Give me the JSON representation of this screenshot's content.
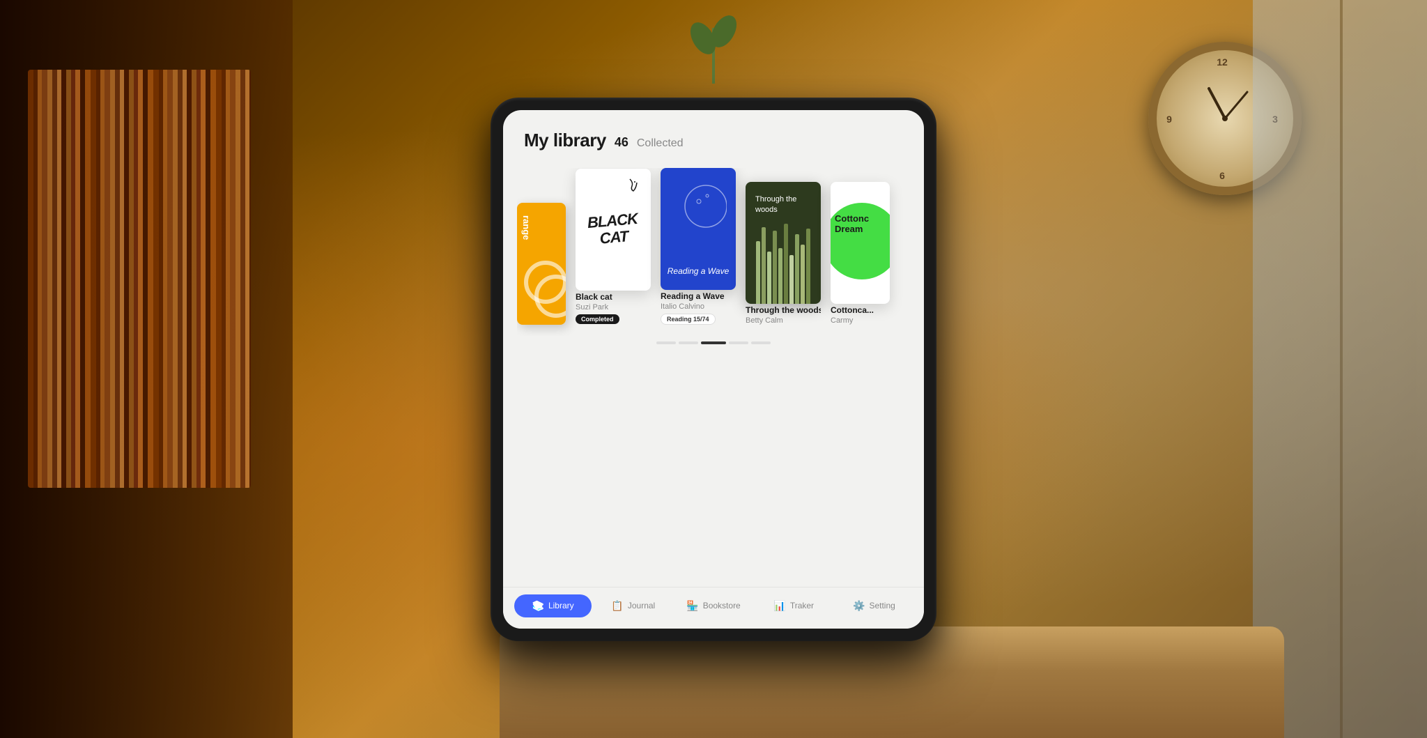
{
  "page": {
    "title": "My library",
    "count": "46",
    "count_label": "Collected"
  },
  "books": [
    {
      "id": "orange",
      "title": "range",
      "author": "",
      "status": null,
      "visible": "partial"
    },
    {
      "id": "black-cat",
      "title": "Black cat",
      "author": "Suzi Park",
      "cover_text": "BLACK CAT",
      "status": "Completed",
      "badge_type": "completed"
    },
    {
      "id": "reading-a-wave",
      "title": "Reading a Wave",
      "author": "Italio Calvino",
      "cover_text": "Reading a Wave",
      "status": "Reading  15/74",
      "badge_type": "reading"
    },
    {
      "id": "through-the-woods",
      "title": "Through the woods",
      "author": "Betty Calm",
      "cover_text": "Through the woods",
      "status": null,
      "badge_type": null
    },
    {
      "id": "cottoncandy",
      "title": "Cottonca...",
      "author": "Carmy",
      "cover_text": "Cottonc Dream",
      "status": null,
      "visible": "partial"
    }
  ],
  "nav": {
    "items": [
      {
        "id": "library",
        "label": "Library",
        "icon": "📚",
        "active": true
      },
      {
        "id": "journal",
        "label": "Journal",
        "icon": "📋",
        "active": false
      },
      {
        "id": "bookstore",
        "label": "Bookstore",
        "icon": "🏪",
        "active": false
      },
      {
        "id": "tracker",
        "label": "Traker",
        "icon": "📊",
        "active": false
      },
      {
        "id": "setting",
        "label": "Setting",
        "icon": "⚙️",
        "active": false
      }
    ]
  },
  "scroll": {
    "dots": [
      {
        "active": false
      },
      {
        "active": false
      },
      {
        "active": true
      },
      {
        "active": false
      },
      {
        "active": false
      }
    ]
  },
  "colors": {
    "accent": "#4466ff",
    "completed_badge": "#1a1a1a",
    "reading_badge_bg": "#ffffff"
  }
}
